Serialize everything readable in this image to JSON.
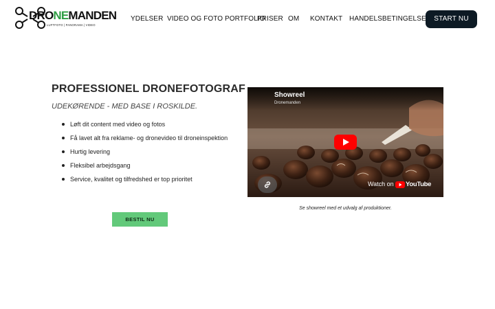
{
  "brand": {
    "name_part1": "DRO",
    "name_part2": "NE",
    "name_part3": "MANDEN",
    "tagline": "LUFTFOTO | PANORAMA | VIDEO",
    "accent_color": "#2f9e44"
  },
  "nav": {
    "items": [
      {
        "label": "YDELSER"
      },
      {
        "label": "VIDEO OG FOTO PORTFOLIO"
      },
      {
        "label": "PRISER"
      },
      {
        "label": "OM"
      },
      {
        "label": "KONTAKT"
      },
      {
        "label": "HANDELSBETINGELSER"
      }
    ],
    "cta_label": "START NU",
    "cta_color": "#0d1a24"
  },
  "hero": {
    "title": "PROFESSIONEL DRONEFOTOGRAF",
    "subtitle": "UDEKØRENDE - MED BASE I ROSKILDE.",
    "bullets": [
      "Løft dit content med video og fotos",
      "Få lavet alt fra reklame- og dronevideo til droneinspektion",
      "Hurtig levering",
      "Fleksibel arbejdsgang",
      "Service, kvalitet og tilfredshed er top prioritet"
    ],
    "order_button": "BESTIL NU",
    "order_button_color": "#62c97a"
  },
  "video": {
    "title": "Showreel",
    "channel": "Dronemanden",
    "watch_on": "Watch on",
    "platform": "YouTube",
    "play_icon": "youtube-play-icon",
    "link_icon": "link-icon",
    "caption": "Se showreel med et udvalg af produktioner."
  }
}
